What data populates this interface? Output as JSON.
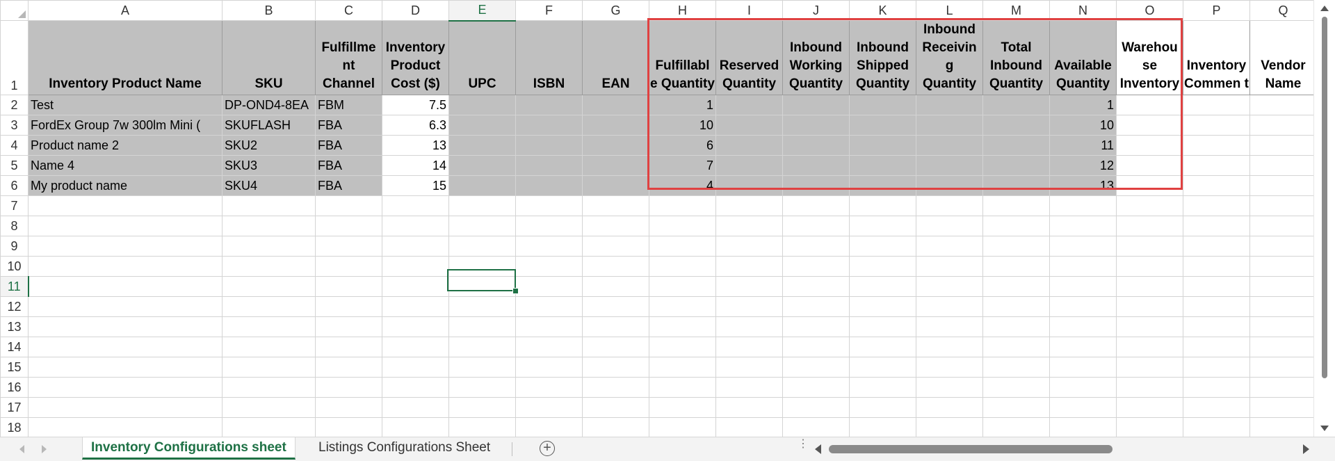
{
  "columns": [
    "A",
    "B",
    "C",
    "D",
    "E",
    "F",
    "G",
    "H",
    "I",
    "J",
    "K",
    "L",
    "M",
    "N",
    "O",
    "P",
    "Q"
  ],
  "active_column": "E",
  "row_numbers": [
    "1",
    "2",
    "3",
    "4",
    "5",
    "6",
    "7",
    "8",
    "9",
    "10",
    "11",
    "12",
    "13",
    "14",
    "15",
    "16",
    "17",
    "18"
  ],
  "active_row": "11",
  "headers": {
    "A": "Inventory Product Name",
    "B": "SKU",
    "C": "Fulfillme nt Channel",
    "D": "Inventory Product Cost ($)",
    "E": "UPC",
    "F": "ISBN",
    "G": "EAN",
    "H": "Fulfillabl e Quantity",
    "I": "Reserved Quantity",
    "J": "Inbound Working Quantity",
    "K": "Inbound Shipped Quantity",
    "L": "Inbound Receivin g Quantity",
    "M": "Total Inbound Quantity",
    "N": "Available Quantity",
    "O": "Warehou se Inventory",
    "P": "Inventory Commen t",
    "Q": "Vendor Name"
  },
  "rows": [
    {
      "A": "Test",
      "B": "DP-OND4-8EA",
      "C": "FBM",
      "D": "7.5",
      "H": "1",
      "N": "1"
    },
    {
      "A": "FordEx Group 7w 300lm Mini (",
      "B": "SKUFLASH",
      "C": "FBA",
      "D": "6.3",
      "H": "10",
      "N": "10"
    },
    {
      "A": "Product name 2",
      "B": "SKU2",
      "C": "FBA",
      "D": "13",
      "H": "6",
      "N": "11"
    },
    {
      "A": "Name 4",
      "B": "SKU3",
      "C": "FBA",
      "D": "14",
      "H": "7",
      "N": "12"
    },
    {
      "A": "My product name",
      "B": "SKU4",
      "C": "FBA",
      "D": "15",
      "H": "4",
      "N": "13"
    }
  ],
  "sheet_tabs": [
    "Inventory Configurations sheet",
    "Listings Configurations Sheet"
  ],
  "active_tab": "Inventory Configurations sheet",
  "add_sheet_symbol": "+",
  "colors": {
    "header_fill": "#c0c0c0",
    "accent": "#1e7145",
    "highlight_box": "#e04141"
  }
}
